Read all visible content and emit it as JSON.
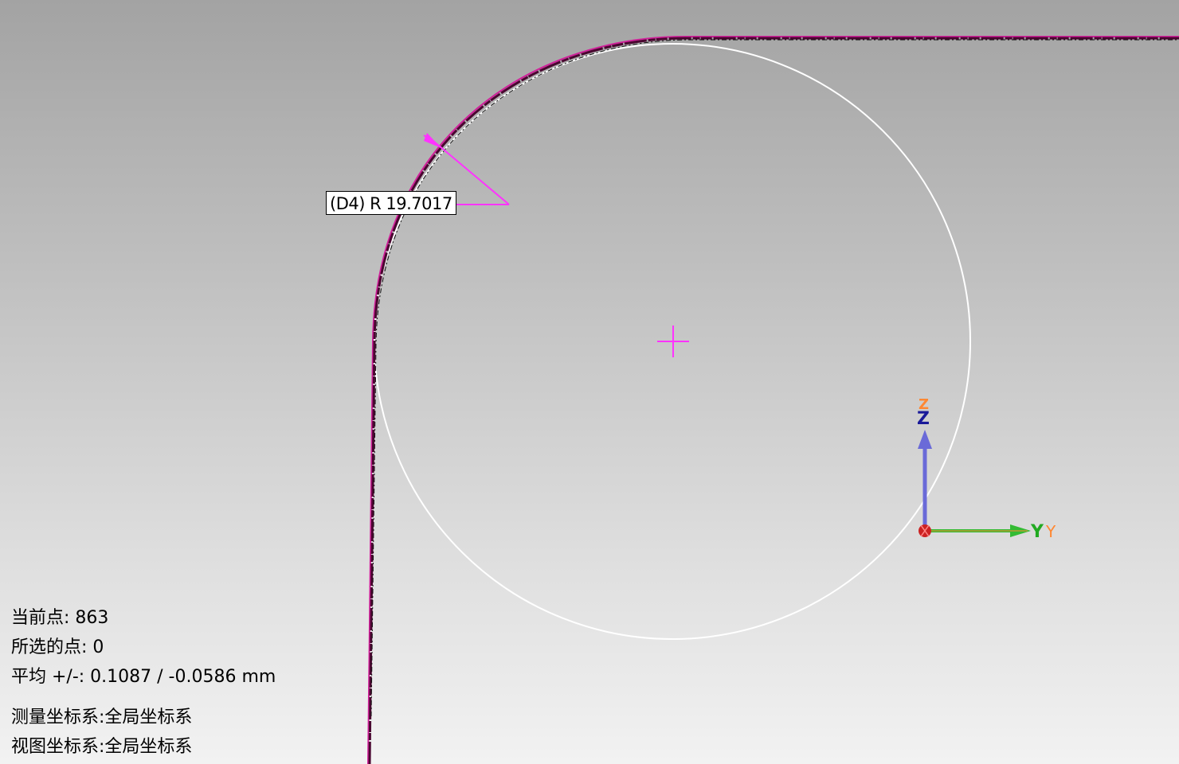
{
  "dimension": {
    "label": "(D4) R 19.7017",
    "color": "#ff33ff"
  },
  "triad": {
    "z_label": "Z",
    "z_label_secondary": "Z",
    "y_label": "Y",
    "y_label_secondary": "Y",
    "z_color": "#6a6ad8",
    "y_color": "#33bb33",
    "x_color": "#cc2222",
    "secondary_color": "#ff8833"
  },
  "profile": {
    "scan_color": "#4a0630",
    "nominal_color": "#d0209a"
  },
  "fitted_circle": {
    "color": "#ffffff",
    "center_marker_color": "#ff33ff"
  },
  "info": {
    "current_point": "当前点: 863",
    "selected_points": "所选的点: 0",
    "average": "平均 +/-: 0.1087 / -0.0586 mm",
    "measure_cs": "测量坐标系:全局坐标系",
    "view_cs": "视图坐标系:全局坐标系"
  }
}
